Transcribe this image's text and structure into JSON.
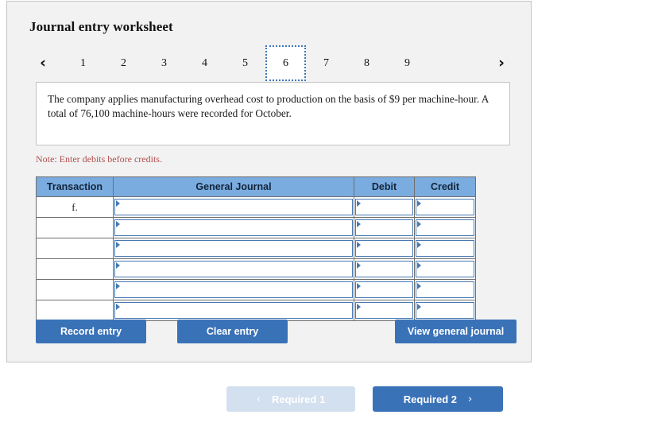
{
  "panel": {
    "title": "Journal entry worksheet"
  },
  "tabs": {
    "prev_icon": "chevron-left-icon",
    "next_icon": "chevron-right-icon",
    "prev_glyph": "‹",
    "next_glyph": "›",
    "items": [
      {
        "label": "1",
        "selected": false
      },
      {
        "label": "2",
        "selected": false
      },
      {
        "label": "3",
        "selected": false
      },
      {
        "label": "4",
        "selected": false
      },
      {
        "label": "5",
        "selected": false
      },
      {
        "label": "6",
        "selected": true
      },
      {
        "label": "7",
        "selected": false
      },
      {
        "label": "8",
        "selected": false
      },
      {
        "label": "9",
        "selected": false
      }
    ],
    "selected_label": "6"
  },
  "description": {
    "text": "The company applies manufacturing overhead cost to production on the basis of $9 per machine-hour. A total of 76,100 machine-hours were recorded for October."
  },
  "note": {
    "text": "Note: Enter debits before credits."
  },
  "table": {
    "columns": [
      "Transaction",
      "General Journal",
      "Debit",
      "Credit"
    ],
    "rows": [
      {
        "transaction": "f.",
        "general_journal": "",
        "debit": "",
        "credit": ""
      },
      {
        "transaction": "",
        "general_journal": "",
        "debit": "",
        "credit": ""
      },
      {
        "transaction": "",
        "general_journal": "",
        "debit": "",
        "credit": ""
      },
      {
        "transaction": "",
        "general_journal": "",
        "debit": "",
        "credit": ""
      },
      {
        "transaction": "",
        "general_journal": "",
        "debit": "",
        "credit": ""
      },
      {
        "transaction": "",
        "general_journal": "",
        "debit": "",
        "credit": ""
      }
    ]
  },
  "actions": {
    "record_label": "Record entry",
    "clear_label": "Clear entry",
    "view_label": "View general journal"
  },
  "pager": {
    "prev_label": "Required 1",
    "next_label": "Required 2",
    "prev_icon": "chevron-left-icon",
    "next_icon": "chevron-right-icon",
    "prev_glyph": "‹",
    "next_glyph": "›",
    "prev_disabled": true
  },
  "colors": {
    "panel_bg": "#f2f2f2",
    "header_blue": "#7aace0",
    "button_blue": "#3a72b8",
    "disabled_blue": "#d3e0ef",
    "note_red": "#b0504f",
    "field_border": "#4679b2"
  }
}
